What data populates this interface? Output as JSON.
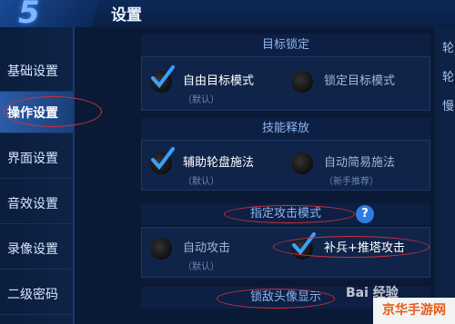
{
  "header": {
    "logo_text": "5",
    "title": "设置"
  },
  "sidebar": {
    "items": [
      {
        "label": "基础设置",
        "active": false
      },
      {
        "label": "操作设置",
        "active": true
      },
      {
        "label": "界面设置",
        "active": false
      },
      {
        "label": "音效设置",
        "active": false
      },
      {
        "label": "录像设置",
        "active": false
      },
      {
        "label": "二级密码",
        "active": false
      }
    ]
  },
  "sections": {
    "target_lock": {
      "title": "目标锁定",
      "options": [
        {
          "label": "自由目标模式",
          "sub": "（默认）",
          "checked": true
        },
        {
          "label": "锁定目标模式",
          "sub": "",
          "checked": false
        }
      ]
    },
    "skill_release": {
      "title": "技能释放",
      "options": [
        {
          "label": "辅助轮盘施法",
          "sub": "（默认）",
          "checked": true
        },
        {
          "label": "自动简易施法",
          "sub": "（新手推荐）",
          "checked": false
        }
      ]
    },
    "attack_mode": {
      "title": "指定攻击模式",
      "help_icon": "?",
      "options": [
        {
          "label": "自动攻击",
          "sub": "（默认）",
          "checked": false
        },
        {
          "label": "补兵+推塔攻击",
          "sub": "",
          "checked": true
        }
      ]
    },
    "lock_enemy": {
      "title": "锁敌头像显示"
    }
  },
  "right_partial": {
    "label1": "轮",
    "label2": "轮",
    "label3": "慢"
  },
  "watermark": {
    "text": "Bai 经验"
  },
  "brand": {
    "text": "京华手游网"
  },
  "colors": {
    "accent": "#2f7be0",
    "annotation": "#d0303a",
    "check": "#3aa0ff"
  }
}
